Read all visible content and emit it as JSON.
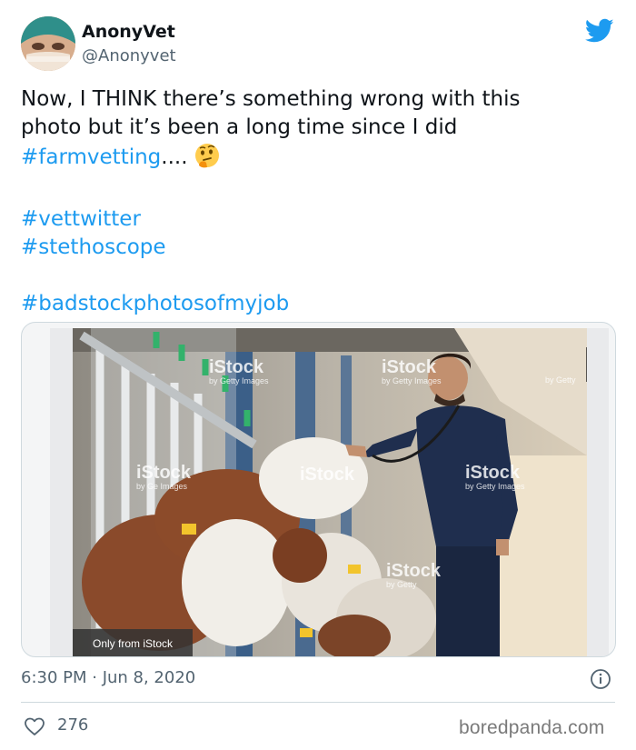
{
  "author": {
    "display_name": "AnonyVet",
    "handle": "@Anonyvet"
  },
  "tweet": {
    "line1": "Now, I THINK there’s something wrong with this",
    "line2": "photo but it’s been a long time since I did",
    "hashtag1": "#farmvetting",
    "after_hashtag1": "....",
    "emoji": "thinking-face",
    "hashtag2": "#vettwitter",
    "hashtag3": "#stethoscope",
    "hashtag4": "#badstockphotosofmyjob"
  },
  "media": {
    "expand_symbol": "+",
    "watermark_brand": "iStock",
    "watermark_sub_full": "by Getty Images",
    "watermark_sub_getty": "by Getty",
    "watermark_sub_images": "Getty Images",
    "watermark_sub_ge_images": "by Ge  Images",
    "label": "Only from iStock"
  },
  "meta": {
    "timestamp": "6:30 PM · Jun 8, 2020",
    "likes": "276"
  },
  "site_mark": "boredpanda.com",
  "colors": {
    "link": "#1d9bf0",
    "twitter_blue": "#1d9bf0",
    "secondary_text": "#536471"
  }
}
